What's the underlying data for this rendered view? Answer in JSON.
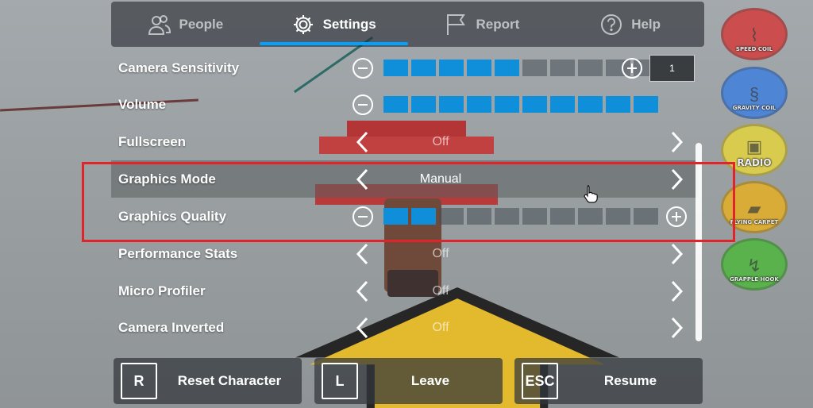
{
  "tabs": [
    {
      "label": "People",
      "icon": "people-icon",
      "active": false
    },
    {
      "label": "Settings",
      "icon": "gear-icon",
      "active": true
    },
    {
      "label": "Report",
      "icon": "flag-icon",
      "active": false
    },
    {
      "label": "Help",
      "icon": "help-icon",
      "active": false
    }
  ],
  "settings": {
    "camera_sensitivity": {
      "label": "Camera Sensitivity",
      "level": 5,
      "max": 10,
      "value": "1"
    },
    "volume": {
      "label": "Volume",
      "level": 10,
      "max": 10
    },
    "fullscreen": {
      "label": "Fullscreen",
      "value": "Off"
    },
    "graphics_mode": {
      "label": "Graphics Mode",
      "value": "Manual"
    },
    "graphics_quality": {
      "label": "Graphics Quality",
      "level": 2,
      "max": 10
    },
    "performance_stats": {
      "label": "Performance Stats",
      "value": "Off"
    },
    "micro_profiler": {
      "label": "Micro Profiler",
      "value": "Off"
    },
    "camera_inverted": {
      "label": "Camera Inverted",
      "value": "Off"
    }
  },
  "buttons": {
    "reset": {
      "key": "R",
      "label": "Reset Character"
    },
    "leave": {
      "key": "L",
      "label": "Leave"
    },
    "resume": {
      "key": "ESC",
      "label": "Resume"
    }
  },
  "tools": [
    {
      "label": "Speed Coil",
      "color": "#d63a3a",
      "icon": "coil-icon"
    },
    {
      "label": "Gravity Coil",
      "color": "#3d7fe0",
      "icon": "spring-icon"
    },
    {
      "label": "Radio",
      "color": "#e6d53b",
      "icon": "speaker-icon"
    },
    {
      "label": "Flying Carpet",
      "color": "#e8b020",
      "icon": "carpet-icon"
    },
    {
      "label": "Grapple Hook",
      "color": "#4cb83a",
      "icon": "hook-icon"
    }
  ],
  "colors": {
    "accent": "#00a2ff",
    "slider_on": "#0f8ed9",
    "highlight_border": "#e0242a"
  }
}
